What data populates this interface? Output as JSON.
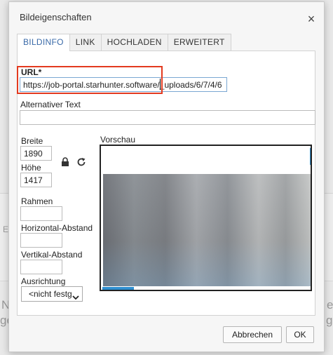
{
  "background": {
    "left_letters": [
      "N",
      "ge"
    ],
    "right_letters": [
      "e",
      "ge"
    ],
    "mid_letter": "E"
  },
  "dialog": {
    "title": "Bildeigenschaften",
    "close_label": "×",
    "tabs": [
      {
        "label": "BILDINFO",
        "active": true
      },
      {
        "label": "LINK",
        "active": false
      },
      {
        "label": "HOCHLADEN",
        "active": false
      },
      {
        "label": "ERWEITERT",
        "active": false
      }
    ],
    "url": {
      "label": "URL*",
      "value": "https://job-portal.starhunter.software/_uploads/6/7/4/6"
    },
    "alt_text": {
      "label": "Alternativer Text",
      "value": ""
    },
    "width": {
      "label": "Breite",
      "value": "1890"
    },
    "height": {
      "label": "Höhe",
      "value": "1417"
    },
    "border": {
      "label": "Rahmen",
      "value": ""
    },
    "hspace": {
      "label": "Horizontal-Abstand",
      "value": ""
    },
    "vspace": {
      "label": "Vertikal-Abstand",
      "value": ""
    },
    "align": {
      "label": "Ausrichtung",
      "selected": "<nicht festg"
    },
    "preview": {
      "label": "Vorschau"
    },
    "icons": {
      "lock": "lock-icon",
      "reset": "reset-size-icon"
    },
    "buttons": {
      "cancel": "Abbrechen",
      "ok": "OK"
    }
  },
  "colors": {
    "accent": "#3a6aa8",
    "highlight_box": "#e33a1f",
    "scrollbar": "#2f8fd0"
  }
}
